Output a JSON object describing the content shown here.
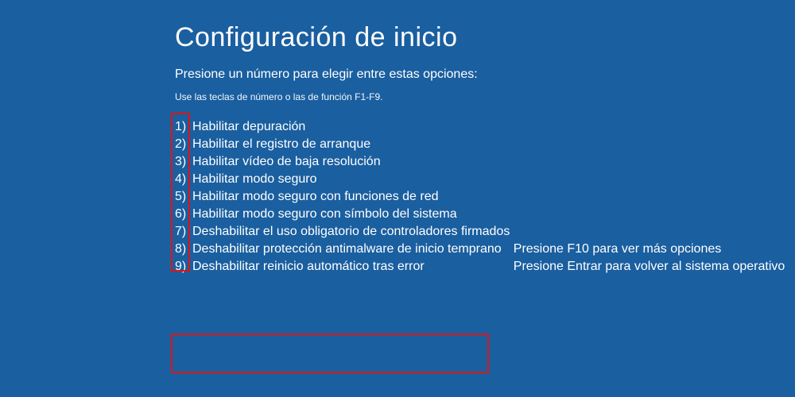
{
  "screen": {
    "title": "Configuración de inicio",
    "subtitle": "Presione un número para elegir entre estas opciones:",
    "hint": "Use las teclas de número o las de función F1-F9.",
    "options": [
      {
        "num": "1)",
        "label": "Habilitar depuración"
      },
      {
        "num": "2)",
        "label": "Habilitar el registro de arranque"
      },
      {
        "num": "3)",
        "label": "Habilitar vídeo de baja resolución"
      },
      {
        "num": "4)",
        "label": "Habilitar modo seguro"
      },
      {
        "num": "5)",
        "label": "Habilitar modo seguro con funciones de red"
      },
      {
        "num": "6)",
        "label": "Habilitar modo seguro con símbolo del sistema"
      },
      {
        "num": "7)",
        "label": "Deshabilitar el uso obligatorio de controladores firmados"
      },
      {
        "num": "8)",
        "label": "Deshabilitar protección antimalware de inicio temprano"
      },
      {
        "num": "9)",
        "label": "Deshabilitar reinicio automático tras error"
      }
    ],
    "footer": {
      "line1": "Presione F10 para ver más opciones",
      "line2": "Presione Entrar para volver al sistema operativo"
    }
  },
  "annotations": {
    "highlight_color": "#e01414"
  }
}
